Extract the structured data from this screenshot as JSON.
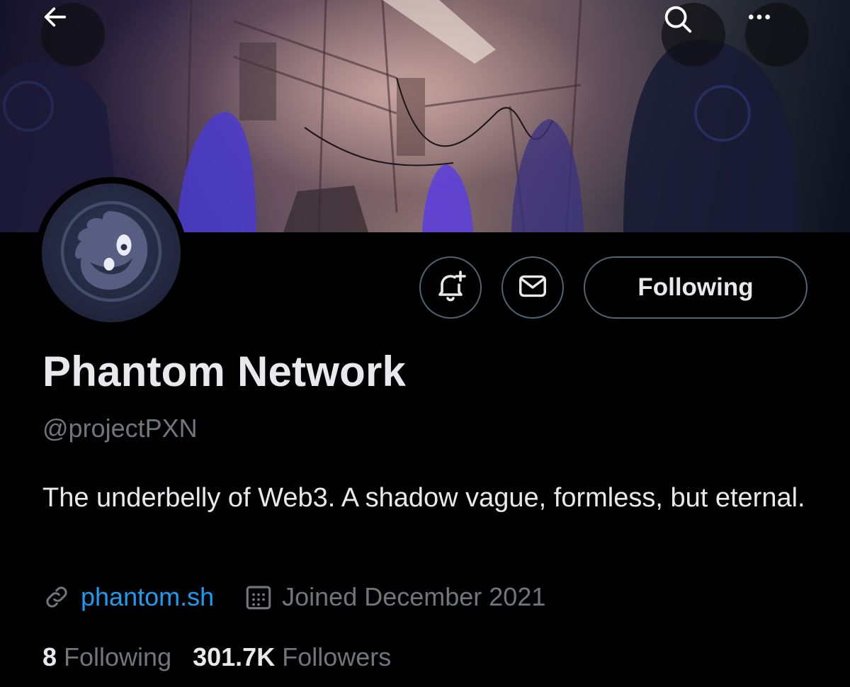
{
  "header": {
    "back_icon": "arrow-left-icon",
    "search_icon": "search-icon",
    "more_icon": "more-horizontal-icon"
  },
  "banner": {
    "description_icon": "phantom-banner-image"
  },
  "profile": {
    "avatar_icon": "phantom-logo-icon",
    "name": "Phantom Network",
    "handle": "@projectPXN",
    "bio": "The underbelly of Web3. A shadow vague, formless, but eternal.",
    "website": "phantom.sh",
    "joined": "Joined December 2021",
    "following_count": "8",
    "following_label": "Following",
    "followers_count": "301.7K",
    "followers_label": "Followers"
  },
  "actions": {
    "notify_icon": "bell-plus-icon",
    "message_icon": "mail-icon",
    "following_button": "Following"
  },
  "colors": {
    "background": "#000000",
    "link": "#1d9bf0",
    "secondary_text": "#71767b",
    "primary_text": "#e7e9ea",
    "border": "#536471"
  }
}
